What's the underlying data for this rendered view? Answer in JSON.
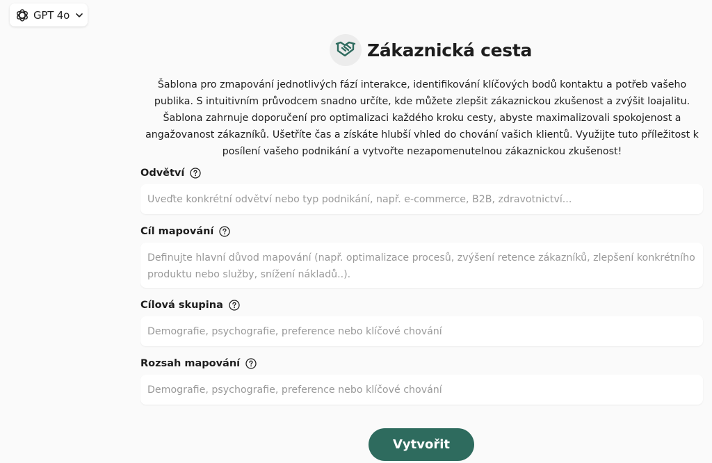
{
  "model_selector": {
    "label": "GPT 4o",
    "icon": "openai-logo-icon",
    "dropdown_icon": "chevron-down-icon"
  },
  "header": {
    "title": "Zákaznická cesta",
    "icon": "handshake-icon",
    "icon_color": "#2e6b5e"
  },
  "description": "Šablona pro zmapování jednotlivých fází interakce, identifikování klíčových bodů kontaktu a potřeb vašeho publika. S intuitivním průvodcem snadno určíte, kde můžete zlepšit zákaznickou zkušenost a zvýšit loajalitu. Šablona zahrnuje doporučení pro optimalizaci každého kroku cesty, abyste maximalizovali spokojenost a angažovanost zákazníků. Ušetříte čas a získáte hlubší vhled do chování vašich klientů. Využijte tuto příležitost k posílení vašeho podnikání a vytvořte nezapomenutelnou zákaznickou zkušenost!",
  "fields": [
    {
      "label": "Odvětví",
      "value": "",
      "placeholder": "Uveďte konkrétní odvětví nebo typ podnikání, např. e-commerce, B2B, zdravotnictví..."
    },
    {
      "label": "Cíl mapování",
      "value": "",
      "placeholder": "Definujte hlavní důvod mapování (např. optimalizace procesů, zvýšení retence zákazníků, zlepšení konkrétního produktu nebo služby, snížení nákladů..)."
    },
    {
      "label": "Cílová skupina",
      "value": "",
      "placeholder": "Demografie, psychografie, preference nebo klíčové chování"
    },
    {
      "label": "Rozsah mapování",
      "value": "",
      "placeholder": "Demografie, psychografie, preference nebo klíčové chování"
    }
  ],
  "help_icon": "question-circle-icon",
  "submit": {
    "label": "Vytvořit",
    "color": "#2e6b5e"
  }
}
